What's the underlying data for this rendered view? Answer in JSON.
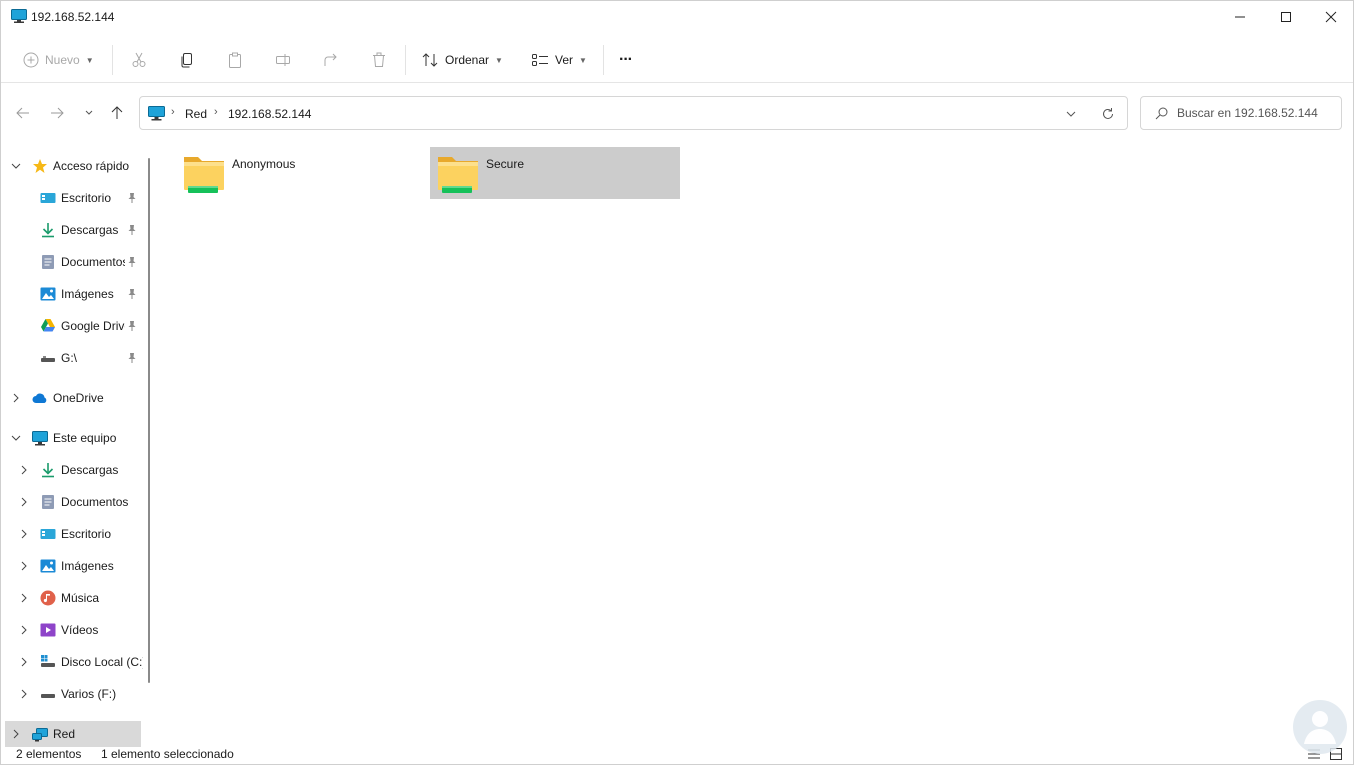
{
  "window": {
    "title": "192.168.52.144"
  },
  "toolbar": {
    "new_label": "Nuevo",
    "sort_label": "Ordenar",
    "view_label": "Ver",
    "more_label": "···"
  },
  "address": {
    "crumbs": [
      "Red",
      "192.168.52.144"
    ]
  },
  "search": {
    "placeholder": "Buscar en 192.168.52.144"
  },
  "sidebar": {
    "quick_access": {
      "label": "Acceso rápido",
      "items": [
        {
          "label": "Escritorio",
          "icon": "desktop-icon"
        },
        {
          "label": "Descargas",
          "icon": "download-icon"
        },
        {
          "label": "Documentos",
          "icon": "documents-icon"
        },
        {
          "label": "Imágenes",
          "icon": "pictures-icon"
        },
        {
          "label": "Google Drive",
          "icon": "google-drive-icon"
        },
        {
          "label": "G:\\",
          "icon": "drive-icon"
        }
      ]
    },
    "onedrive": {
      "label": "OneDrive"
    },
    "this_pc": {
      "label": "Este equipo",
      "items": [
        {
          "label": "Descargas",
          "icon": "download-icon"
        },
        {
          "label": "Documentos",
          "icon": "documents-icon"
        },
        {
          "label": "Escritorio",
          "icon": "desktop-icon"
        },
        {
          "label": "Imágenes",
          "icon": "pictures-icon"
        },
        {
          "label": "Música",
          "icon": "music-icon"
        },
        {
          "label": "Vídeos",
          "icon": "videos-icon"
        },
        {
          "label": "Disco Local (C:)",
          "icon": "local-disk-icon"
        },
        {
          "label": "Varios (F:)",
          "icon": "drive-icon"
        }
      ]
    },
    "network": {
      "label": "Red"
    }
  },
  "content": {
    "items": [
      {
        "name": "Anonymous",
        "selected": false
      },
      {
        "name": "Secure",
        "selected": true
      }
    ]
  },
  "status": {
    "count": "2 elementos",
    "selection": "1 elemento seleccionado"
  },
  "colors": {
    "selection": "#cccccc",
    "folder": "#f8c84a",
    "share_bar": "#16c15a",
    "accent": "#0078d4"
  }
}
